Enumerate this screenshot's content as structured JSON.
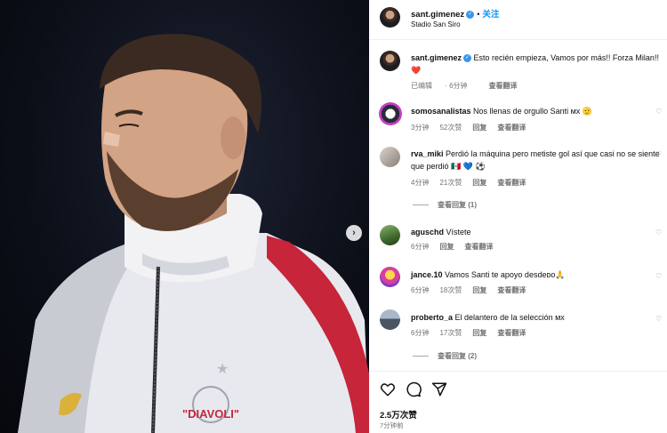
{
  "post": {
    "username": "sant.gimenez",
    "verified_badge": "✓",
    "follow_label": "关注",
    "location": "Stadio San Siro",
    "caption": "Esto recién empieza, Vamos por más!! Forza Milan!! ❤️",
    "caption_edited": "已编辑",
    "caption_time": "6分钟",
    "caption_translate": "查看翻译",
    "jersey_text": "\"DIAVOLI\""
  },
  "comments": [
    {
      "username": "somosanalistas",
      "text": "Nos llenas de orgullo Santi ᴍx 🫡",
      "time": "3分钟",
      "likes": "52次赞",
      "reply": "回复",
      "translate": "查看翻译",
      "avatar": "team-crest"
    },
    {
      "username": "rva_miki",
      "text": "Perdió la máquina pero metiste gol así que casi no se siente que perdió 🇲🇽 💙 ⚽",
      "time": "4分钟",
      "likes": "21次赞",
      "reply": "回复",
      "translate": "查看翻译",
      "view_replies": "查看回复 (1)",
      "avatar": "photo"
    },
    {
      "username": "aguschd",
      "text": "Vístete",
      "time": "6分钟",
      "reply": "回复",
      "translate": "查看翻译",
      "avatar": "outdoor"
    },
    {
      "username": "jance.10",
      "text": "Vamos Santi te apoyo desdeᴅᴏ🙏",
      "time": "6分钟",
      "likes": "18次赞",
      "reply": "回复",
      "translate": "查看翻译",
      "avatar": "cartoon"
    },
    {
      "username": "proberto_a",
      "text": "El delantero de la selección ᴍx",
      "time": "6分钟",
      "likes": "17次赞",
      "reply": "回复",
      "translate": "查看翻译",
      "view_replies": "查看回复 (2)",
      "avatar": "city"
    }
  ],
  "footer": {
    "likes": "2.5万次赞",
    "posted": "7分钟前"
  },
  "colors": {
    "accent": "#0095f6",
    "verified": "#3897f0",
    "meta_text": "#737373",
    "photo_bg": "#0c0f18"
  },
  "icons": [
    "chevron-right-icon",
    "heart-icon",
    "comment-icon",
    "share-icon",
    "verified-icon"
  ]
}
